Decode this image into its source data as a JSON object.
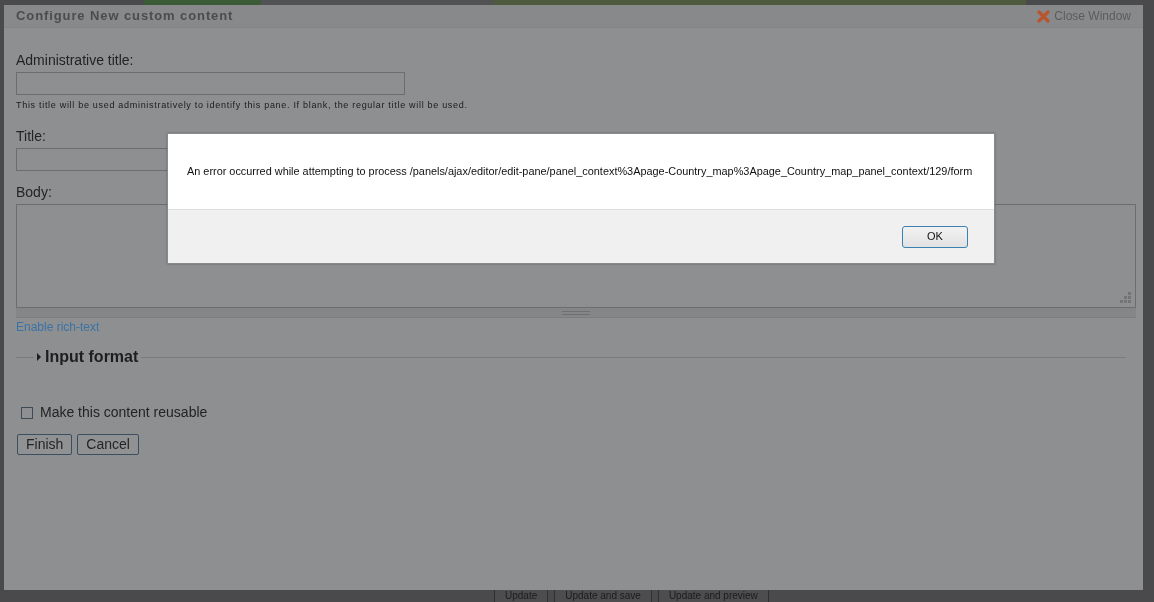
{
  "modal": {
    "title": "Configure New custom content",
    "close_link": "Close Window",
    "fields": [
      {
        "kind": "text",
        "label": "Administrative title:",
        "description": "This title will be used administratively to identify this pane. If blank, the regular title will be used."
      },
      {
        "kind": "text",
        "label": "Title:"
      },
      {
        "kind": "textarea",
        "label": "Body:"
      }
    ],
    "rich_text_link": "Enable rich-text",
    "fieldset": {
      "legend": "Input format",
      "expanded": false
    },
    "checkbox": {
      "label": "Make this content reusable",
      "checked": false
    },
    "buttons": [
      "Finish",
      "Cancel"
    ]
  },
  "alert": {
    "message": "An error occurred while attempting to process /panels/ajax/editor/edit-pane/panel_context%3Apage-Country_map%3Apage_Country_map_panel_context/129/form",
    "button": "OK"
  },
  "background_page": {
    "buttons": [
      "Update",
      "Update and save",
      "Update and preview"
    ]
  }
}
